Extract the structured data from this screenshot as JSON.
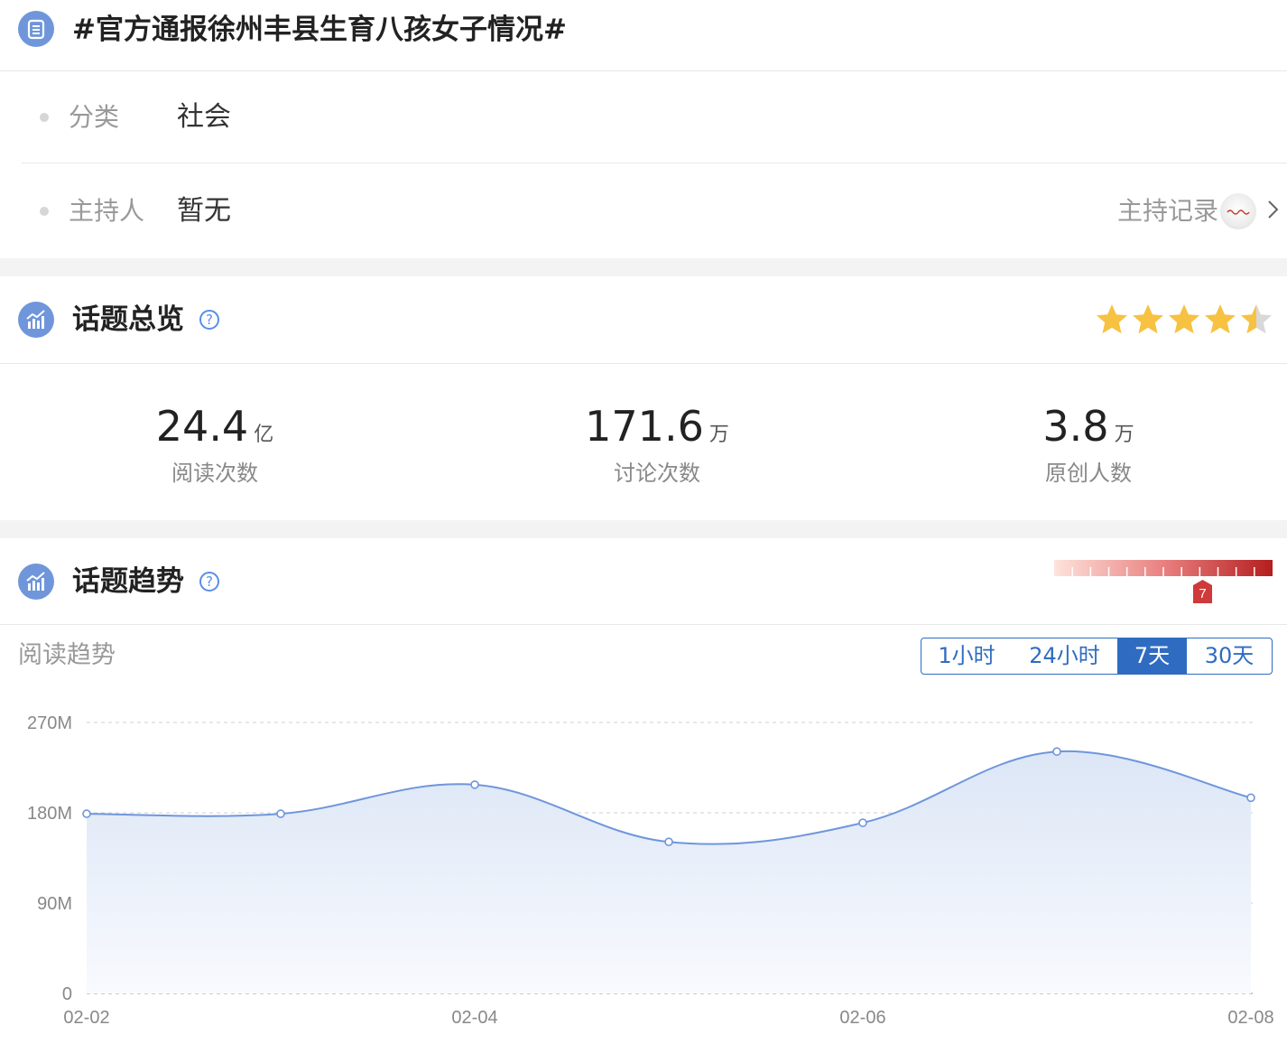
{
  "header": {
    "title": "#官方通报徐州丰县生育八孩女子情况#",
    "icon": "list-icon"
  },
  "info": {
    "category_label": "分类",
    "category_value": "社会",
    "host_label": "主持人",
    "host_value": "暂无",
    "host_record_label": "主持记录"
  },
  "overview": {
    "title": "话题总览",
    "help_glyph": "?",
    "rating_stars": 4.5,
    "stats": [
      {
        "value": "24.4",
        "unit": "亿",
        "label": "阅读次数"
      },
      {
        "value": "171.6",
        "unit": "万",
        "label": "讨论次数"
      },
      {
        "value": "3.8",
        "unit": "万",
        "label": "原创人数"
      }
    ]
  },
  "trend": {
    "title": "话题趋势",
    "help_glyph": "?",
    "heat_level": "7",
    "subtitle": "阅读趋势",
    "ranges": [
      "1小时",
      "24小时",
      "7天",
      "30天"
    ],
    "active_range": "7天"
  },
  "colors": {
    "accent": "#2f6cc1",
    "icon_bg": "#6f96db",
    "star": "#f7c242",
    "line": "#6f96db",
    "heat_dark": "#b41e1e"
  },
  "chart_data": {
    "type": "area",
    "x": [
      "02-02",
      "02-03",
      "02-04",
      "02-05",
      "02-06",
      "02-07",
      "02-08"
    ],
    "values": [
      179,
      179,
      208,
      151,
      170,
      241,
      195
    ],
    "y_ticks": [
      "0",
      "90M",
      "180M",
      "270M"
    ],
    "x_tick_labels": [
      "02-02",
      "02-04",
      "02-06",
      "02-08"
    ],
    "ylim": [
      0,
      270
    ],
    "grid": true
  }
}
